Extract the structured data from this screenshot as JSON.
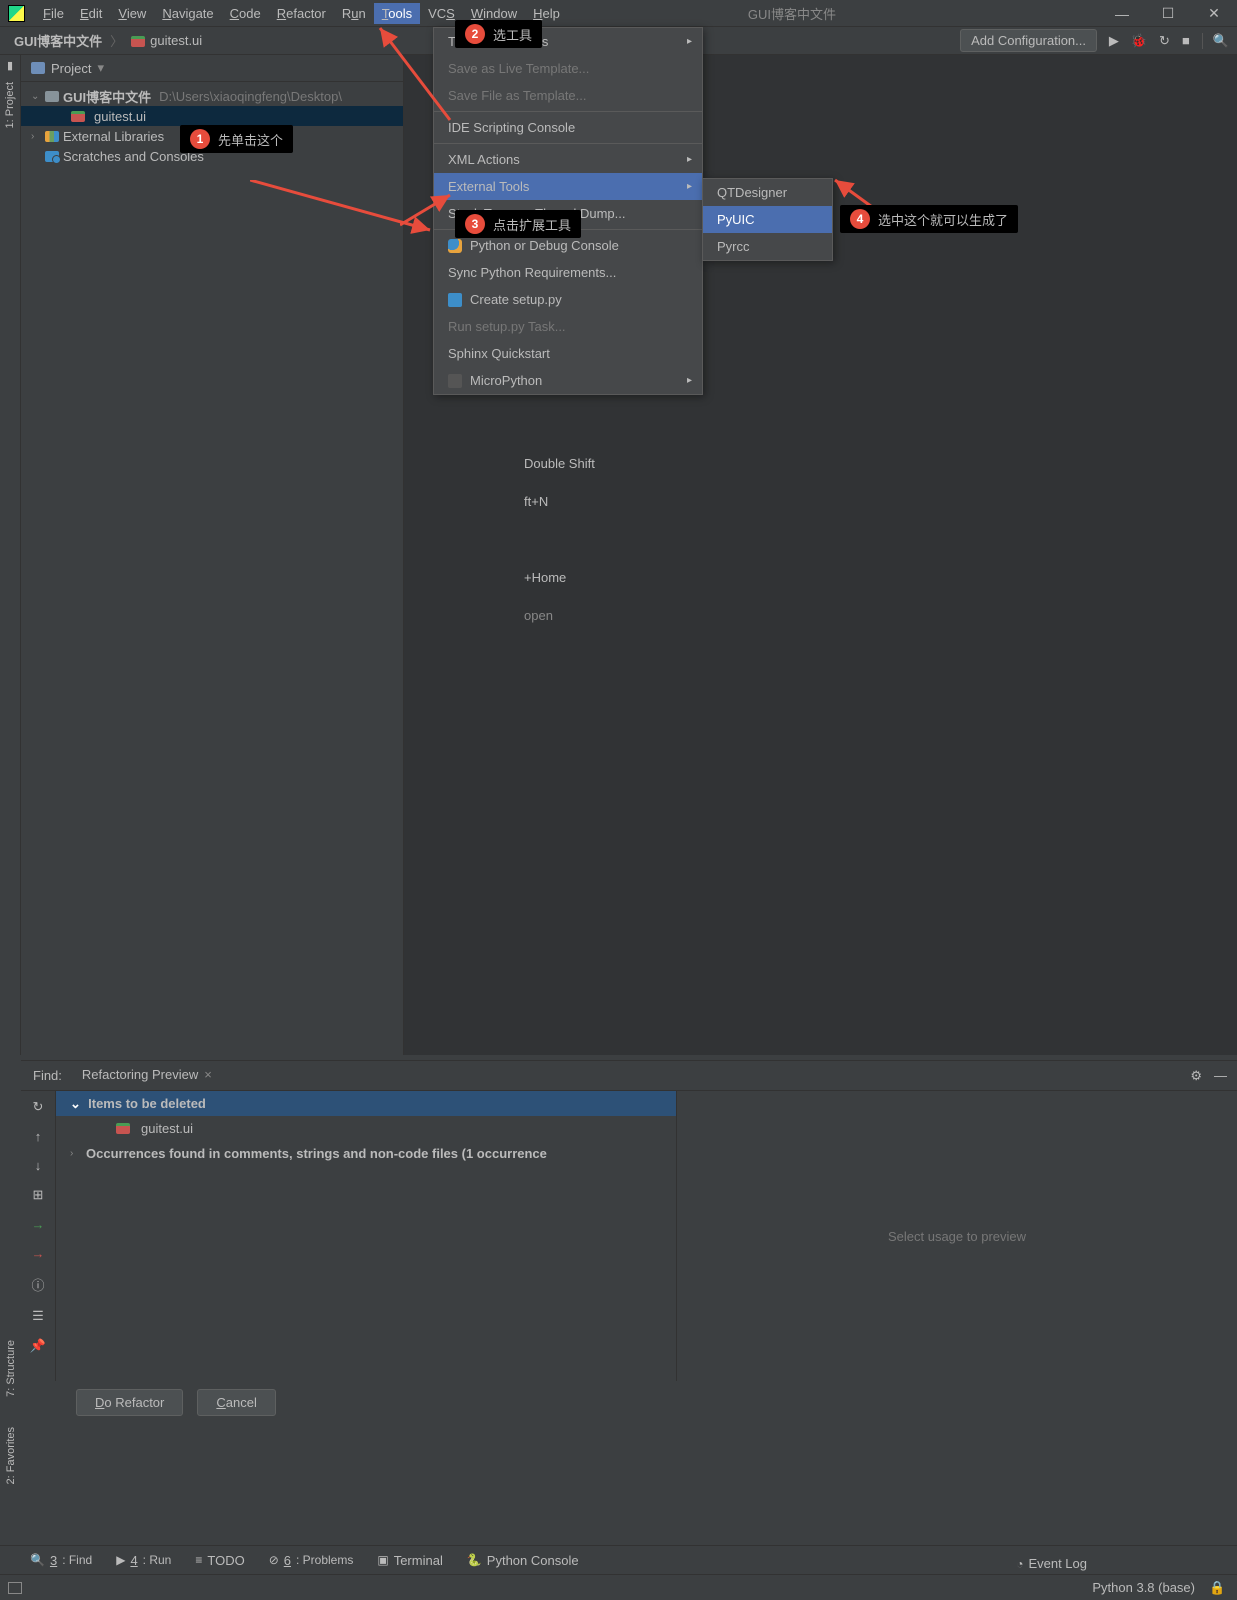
{
  "menubar": {
    "items": [
      "File",
      "Edit",
      "View",
      "Navigate",
      "Code",
      "Refactor",
      "Run",
      "Tools",
      "VCS",
      "Window",
      "Help"
    ],
    "active_index": 7,
    "title": "GUI博客中文件"
  },
  "toolbar": {
    "crumb1": "GUI博客中文件",
    "crumb2": "guitest.ui",
    "add_config": "Add Configuration..."
  },
  "project": {
    "label": "Project",
    "root": "GUI博客中文件",
    "root_path": "D:\\Users\\xiaoqingfeng\\Desktop\\",
    "file": "guitest.ui",
    "ext_lib": "External Libraries",
    "scratch": "Scratches and Consoles",
    "gutter": "1: Project"
  },
  "tools_menu": {
    "items": [
      {
        "label": "Tasks & Contexts",
        "arrow": true,
        "disabled": true
      },
      {
        "label": "Save as Live Template...",
        "disabled": true
      },
      {
        "label": "Save File as Template...",
        "disabled": true
      },
      {
        "sep": true
      },
      {
        "label": "IDE Scripting Console"
      },
      {
        "sep": true
      },
      {
        "label": "XML Actions",
        "arrow": true
      },
      {
        "label": "External Tools",
        "arrow": true,
        "hover": true
      },
      {
        "label": "Stack Trace or Thread Dump..."
      },
      {
        "sep": true
      },
      {
        "label": "Python or Debug Console",
        "icon": "py"
      },
      {
        "label": "Sync Python Requirements..."
      },
      {
        "label": "Create setup.py",
        "icon": "setup"
      },
      {
        "label": "Run setup.py Task...",
        "disabled": true
      },
      {
        "label": "Sphinx Quickstart"
      },
      {
        "label": "MicroPython",
        "arrow": true,
        "disabled": true,
        "icon": "check"
      }
    ]
  },
  "submenu": {
    "items": [
      "QTDesigner",
      "PyUIC",
      "Pyrcc"
    ],
    "hover_index": 1
  },
  "annotations": {
    "a1": "先单击这个",
    "a2": "选工具",
    "a3": "点击扩展工具",
    "a4": "选中这个就可以生成了"
  },
  "welcome": {
    "l1": "Double Shift",
    "l2": "ft+N",
    "l3": "+Home",
    "l4": "open"
  },
  "find": {
    "label": "Find:",
    "tab": "Refactoring Preview",
    "header": "Items to be deleted",
    "file": "guitest.ui",
    "occ": "Occurrences found in comments, strings and non-code files  (1 occurrence",
    "preview": "Select usage to preview",
    "do_refactor": "Do Refactor",
    "cancel": "Cancel"
  },
  "status_tabs": {
    "find": "3: Find",
    "run": "4: Run",
    "todo": "TODO",
    "problems": "6: Problems",
    "terminal": "Terminal",
    "pyconsole": "Python Console",
    "event_log": "Event Log"
  },
  "status_bar": {
    "python": "Python 3.8 (base)"
  },
  "left_tools": {
    "structure": "7: Structure",
    "favorites": "2: Favorites"
  }
}
